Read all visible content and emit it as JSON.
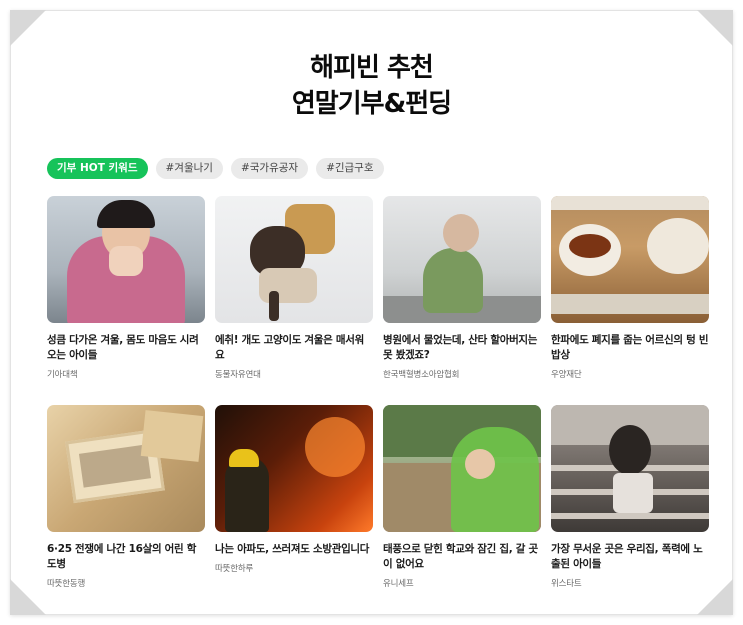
{
  "title": {
    "line1": "해피빈 추천",
    "line2": "연말기부&펀딩"
  },
  "chips": [
    {
      "label": "기부 HOT 키워드",
      "active": true
    },
    {
      "label": "#겨울나기",
      "active": false
    },
    {
      "label": "#국가유공자",
      "active": false
    },
    {
      "label": "#긴급구호",
      "active": false
    }
  ],
  "cards": [
    {
      "title": "성큼 다가온 겨울, 몸도 마음도 시려오는 아이들",
      "org": "기아대책"
    },
    {
      "title": "에취! 개도 고양이도 겨울은 매서워요",
      "org": "동물자유연대"
    },
    {
      "title": "병원에서 물었는데, 산타 할아버지는 못 봤겠죠?",
      "org": "한국백혈병소아암협회"
    },
    {
      "title": "한파에도 폐지를 줍는 어르신의 텅 빈 밥상",
      "org": "우양재단"
    },
    {
      "title": "6·25 전쟁에 나간 16살의 어린 학도병",
      "org": "따뜻한동행"
    },
    {
      "title": "나는 아파도, 쓰러져도 소방관입니다",
      "org": "따뜻한하루"
    },
    {
      "title": "태풍으로 닫힌 학교와 잠긴 집, 갈 곳이 없어요",
      "org": "유니세프"
    },
    {
      "title": "가장 무서운 곳은 우리집, 폭력에 노출된 아이들",
      "org": "위스타트"
    }
  ],
  "colors": {
    "accent": "#16c35a",
    "chip_bg": "#eaeaea"
  }
}
